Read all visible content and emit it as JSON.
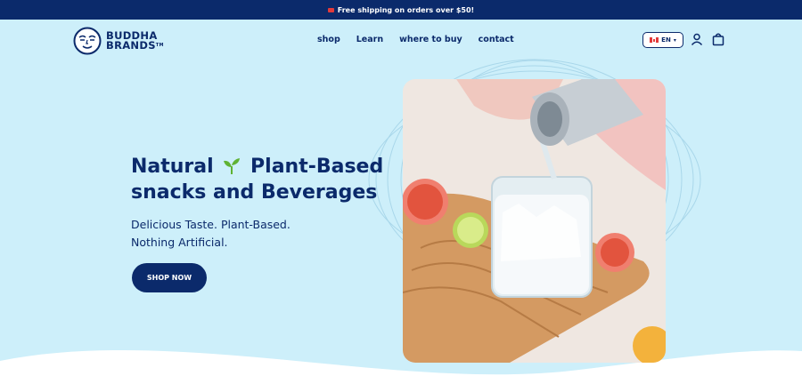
{
  "announcement": {
    "text": "Free shipping on orders over $50!",
    "icon": "flag-icon"
  },
  "brand": {
    "line1": "BUDDHA",
    "line2": "BRANDS",
    "tm": "TM"
  },
  "nav": {
    "items": [
      {
        "label": "shop"
      },
      {
        "label": "Learn"
      },
      {
        "label": "where to buy"
      },
      {
        "label": "contact"
      }
    ]
  },
  "locale": {
    "flag": "ca-flag-icon",
    "language": "EN"
  },
  "header_icons": {
    "account": "user-icon",
    "cart": "shopping-bag-icon"
  },
  "hero": {
    "headline_part1": "Natural",
    "headline_part2": "Plant-Based snacks and Beverages",
    "subtext_line1": "Delicious Taste. Plant-Based.",
    "subtext_line2": "Nothing Artificial.",
    "cta_label": "SHOP NOW",
    "image": "sparkling-drink-photo"
  },
  "colors": {
    "navy": "#0b2a6b",
    "sky": "#cdeffa",
    "white": "#ffffff",
    "sprout_green": "#5fb233"
  }
}
